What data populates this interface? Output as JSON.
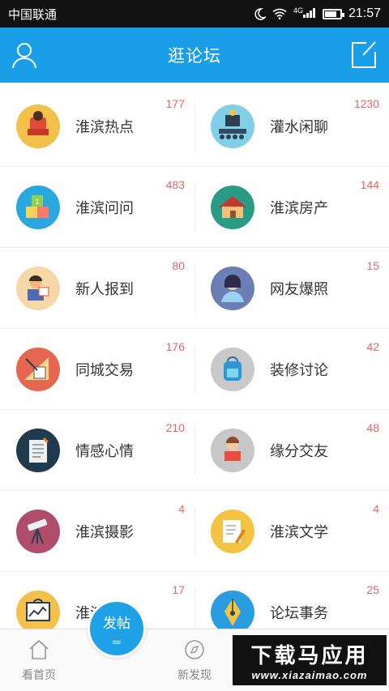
{
  "status_bar": {
    "carrier": "中国联通",
    "network": "4G",
    "time": "21:57",
    "battery_level": 0.8
  },
  "header": {
    "title": "逛论坛",
    "left_icon": "user-icon",
    "right_icon": "compose-icon"
  },
  "forums": [
    {
      "label": "淮滨热点",
      "count": "177",
      "icon": "reading-person-icon",
      "color": "#f2c14a"
    },
    {
      "label": "灌水闲聊",
      "count": "1230",
      "icon": "speaker-crowd-icon",
      "color": "#7fd0e6"
    },
    {
      "label": "淮滨问问",
      "count": "483",
      "icon": "abc-blocks-icon",
      "color": "#2aa7df"
    },
    {
      "label": "淮滨房产",
      "count": "144",
      "icon": "house-icon",
      "color": "#2a9c86"
    },
    {
      "label": "新人报到",
      "count": "80",
      "icon": "newcomer-icon",
      "color": "#f6d7a8"
    },
    {
      "label": "网友爆照",
      "count": "15",
      "icon": "portrait-icon",
      "color": "#6b7fb4"
    },
    {
      "label": "同城交易",
      "count": "176",
      "icon": "ruler-tools-icon",
      "color": "#e6664f"
    },
    {
      "label": "装修讨论",
      "count": "42",
      "icon": "backpack-icon",
      "color": "#c9c9c9"
    },
    {
      "label": "情感心情",
      "count": "210",
      "icon": "notepad-icon",
      "color": "#203a4e"
    },
    {
      "label": "缘分交友",
      "count": "48",
      "icon": "girl-reading-icon",
      "color": "#c7c7c7"
    },
    {
      "label": "淮滨摄影",
      "count": "4",
      "icon": "telescope-icon",
      "color": "#b04d6a"
    },
    {
      "label": "淮滨文学",
      "count": "4",
      "icon": "paper-pen-icon",
      "color": "#f4c342"
    },
    {
      "label": "淮滨商讯",
      "count": "17",
      "icon": "chart-board-icon",
      "color": "#f3c14a"
    },
    {
      "label": "论坛事务",
      "count": "25",
      "icon": "fountain-pen-icon",
      "color": "#2a9de0"
    }
  ],
  "tabbar": {
    "home": "看首页",
    "post": "发帖",
    "discover": "新发现"
  },
  "watermark": {
    "line1": "下载马应用",
    "line2": "www.xiazaimao.com"
  }
}
